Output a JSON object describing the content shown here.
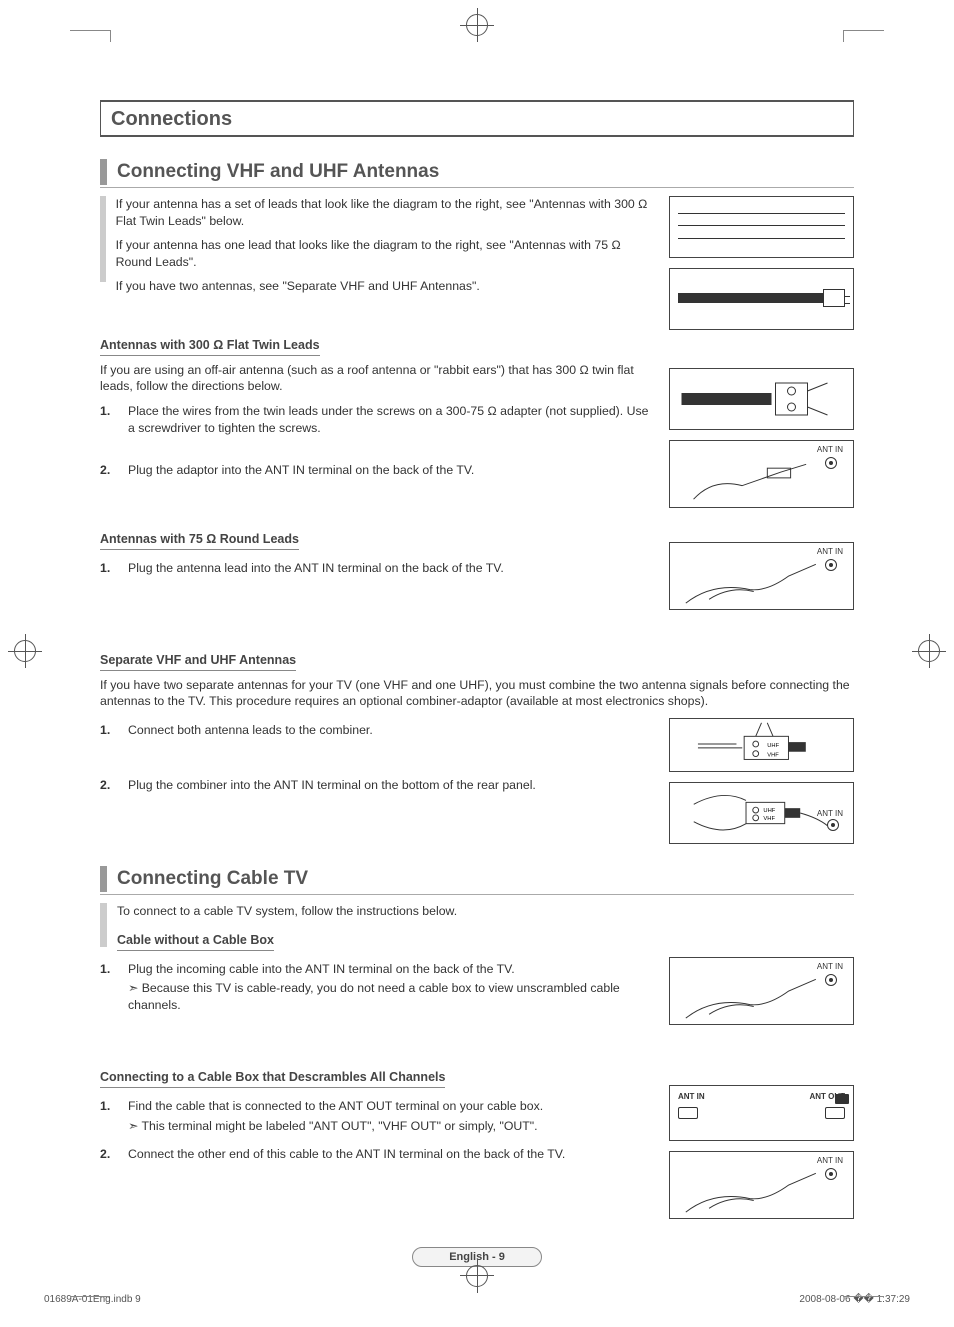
{
  "chapter_title": "Connections",
  "section1": {
    "title": "Connecting VHF and UHF Antennas",
    "intro1": "If your antenna has a set of leads that look like the diagram to the right, see \"Antennas with 300 Ω Flat Twin Leads\" below.",
    "intro2": "If your antenna has one lead that looks like the diagram to the right, see \"Antennas with 75 Ω Round Leads\".",
    "intro3": "If you have two antennas, see \"Separate VHF and UHF Antennas\".",
    "sub1": {
      "title": "Antennas with 300 Ω Flat Twin Leads",
      "lead": "If you are using an off-air antenna (such as a roof antenna or \"rabbit ears\") that has 300 Ω twin flat leads, follow the directions below.",
      "step1": "Place the wires from the twin leads under the screws on a 300-75 Ω adapter (not supplied). Use a screwdriver to tighten the screws.",
      "step2": "Plug the adaptor into the ANT IN terminal on the back of the TV."
    },
    "sub2": {
      "title": "Antennas with 75 Ω Round Leads",
      "step1": "Plug the antenna lead into the ANT IN terminal on the back of the TV."
    },
    "sub3": {
      "title": "Separate VHF and UHF Antennas",
      "lead": "If you have two separate antennas for your TV (one VHF and one UHF), you must combine the two antenna signals before connecting the antennas to the TV. This procedure requires an optional combiner-adaptor (available at most electronics shops).",
      "step1": "Connect both antenna leads to the combiner.",
      "step2": "Plug the combiner into the ANT IN terminal on the bottom of the rear panel."
    }
  },
  "section2": {
    "title": "Connecting Cable TV",
    "intro": "To connect to a cable TV system, follow the instructions below.",
    "sub1": {
      "title": "Cable without a Cable Box",
      "step1": "Plug the incoming cable into the ANT IN terminal on the back of the TV.",
      "note1": "Because this TV is cable-ready, you do not need a cable box to view unscrambled cable channels."
    },
    "sub2": {
      "title": "Connecting to a Cable Box that Descrambles All Channels",
      "step1": "Find the cable that is connected to the ANT OUT terminal on your cable box.",
      "note1": "This terminal might be labeled \"ANT OUT\", \"VHF OUT\" or simply, \"OUT\".",
      "step2": "Connect the other end of this cable to the ANT IN terminal on the back of the TV."
    }
  },
  "diagram_labels": {
    "ant_in": "ANT IN",
    "ant_out": "ANT OUT",
    "uhf": "UHF",
    "vhf": "VHF"
  },
  "page_badge": "English - 9",
  "footer": {
    "left": "01689A-01Eng.indb   9",
    "right": "2008-08-06   �� 1:37:29"
  }
}
